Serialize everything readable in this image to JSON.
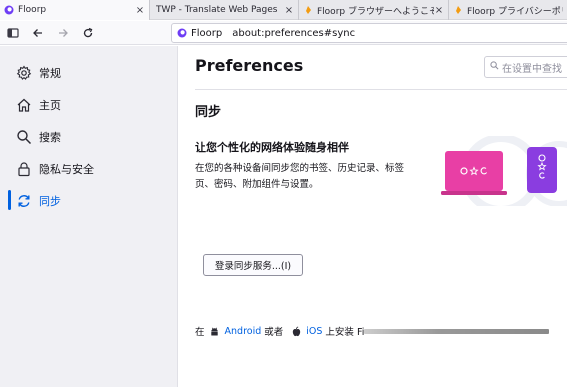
{
  "tabs": [
    {
      "title": "Floorp",
      "close": "×",
      "active": true,
      "icon": "floorp-icon"
    },
    {
      "title": "TWP - Translate Web Pages",
      "close": "×",
      "active": false,
      "icon": "none"
    },
    {
      "title": "Floorp ブラウザーへようこそ！",
      "close": "×",
      "active": false,
      "icon": "puzzle-icon"
    },
    {
      "title": "Floorp プライバシーポリシ",
      "close": "",
      "active": false,
      "icon": "puzzle-icon"
    }
  ],
  "urlbar": {
    "identity": "Floorp",
    "url": "about:preferences#sync"
  },
  "sidebar": {
    "items": [
      {
        "label": "常规",
        "icon": "gear-icon"
      },
      {
        "label": "主页",
        "icon": "home-icon"
      },
      {
        "label": "搜索",
        "icon": "search-icon"
      },
      {
        "label": "隐私与安全",
        "icon": "lock-icon"
      },
      {
        "label": "同步",
        "icon": "sync-icon",
        "selected": true
      }
    ]
  },
  "main": {
    "title": "Preferences",
    "search_placeholder": "在设置中查找",
    "section_title": "同步",
    "sync_heading": "让您个性化的网络体验随身相伴",
    "sync_desc": "在您的各种设备间同步您的书签、历史记录、标签页、密码、附加组件与设置。",
    "signin_button": "登录同步服务...(I)",
    "install": {
      "prefix": "在",
      "android": "Android",
      "or": "或者",
      "ios": "iOS",
      "suffix": "上安装 Fi"
    }
  },
  "colors": {
    "accent": "#0061e0",
    "floorp": "#6e3df5",
    "laptop": "#e83fa5",
    "phone": "#8a3de0"
  }
}
